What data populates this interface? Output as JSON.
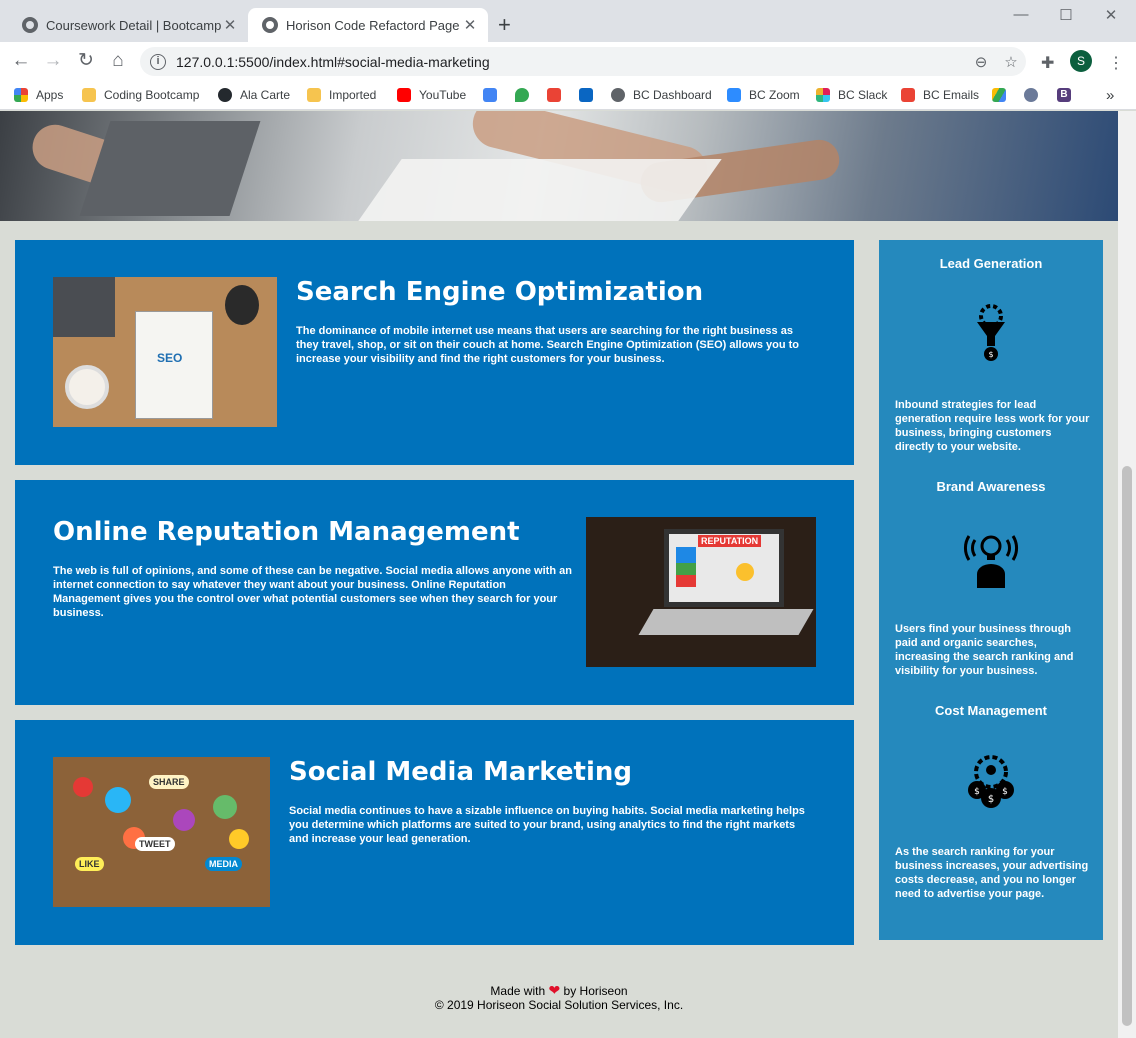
{
  "browser": {
    "tabs": [
      {
        "title": "Coursework Detail | Bootcamp Sp",
        "active": false
      },
      {
        "title": "Horison Code Refactord Page",
        "active": true
      }
    ],
    "url": "127.0.0.1:5500/index.html#social-media-marketing",
    "profile_initial": "S",
    "bookmarks": [
      "Apps",
      "Coding Bootcamp",
      "Ala Carte",
      "Imported",
      "YouTube",
      "BC Dashboard",
      "BC Zoom",
      "BC Slack",
      "BC Emails"
    ],
    "overflow_label": "»"
  },
  "sections": [
    {
      "id": "search-engine-optimization",
      "title": "Search Engine Optimization",
      "text": "The dominance of mobile internet use means that users are searching for the right business as they travel, shop, or sit on their couch at home. Search Engine Optimization (SEO) allows you to increase your visibility and find the right customers for your business.",
      "image_label": "SEO"
    },
    {
      "id": "online-reputation-management",
      "title": "Online Reputation Management",
      "text": "The web is full of opinions, and some of these can be negative. Social media allows anyone with an internet connection to say whatever they want about your business. Online Reputation Management gives you the control over what potential customers see when they search for your business.",
      "image_label": "REPUTATION"
    },
    {
      "id": "social-media-marketing",
      "title": "Social Media Marketing",
      "text": "Social media continues to have a sizable influence on buying habits. Social media marketing helps you determine which platforms are suited to your brand, using analytics to find the right markets and increase your lead generation.",
      "image_labels": [
        "SHARE",
        "TWEET",
        "LIKE",
        "MEDIA"
      ]
    }
  ],
  "benefits": [
    {
      "title": "Lead Generation",
      "text": "Inbound strategies for lead generation require less work for your business, bringing customers directly to your website.",
      "icon": "lead-generation-icon"
    },
    {
      "title": "Brand Awareness",
      "text": "Users find your business through paid and organic searches, increasing the search ranking and visibility for your business.",
      "icon": "brand-awareness-icon"
    },
    {
      "title": "Cost Management",
      "text": "As the search ranking for your business increases, your advertising costs decrease, and you no longer need to advertise your page.",
      "icon": "cost-management-icon"
    }
  ],
  "footer": {
    "made_with": "Made with",
    "by": "by Horiseon",
    "copyright": "© 2019 Horiseon Social Solution Services, Inc."
  },
  "colors": {
    "section_bg": "#0072bb",
    "benefits_bg": "#2589bd",
    "page_bg": "#d9dcd6"
  }
}
